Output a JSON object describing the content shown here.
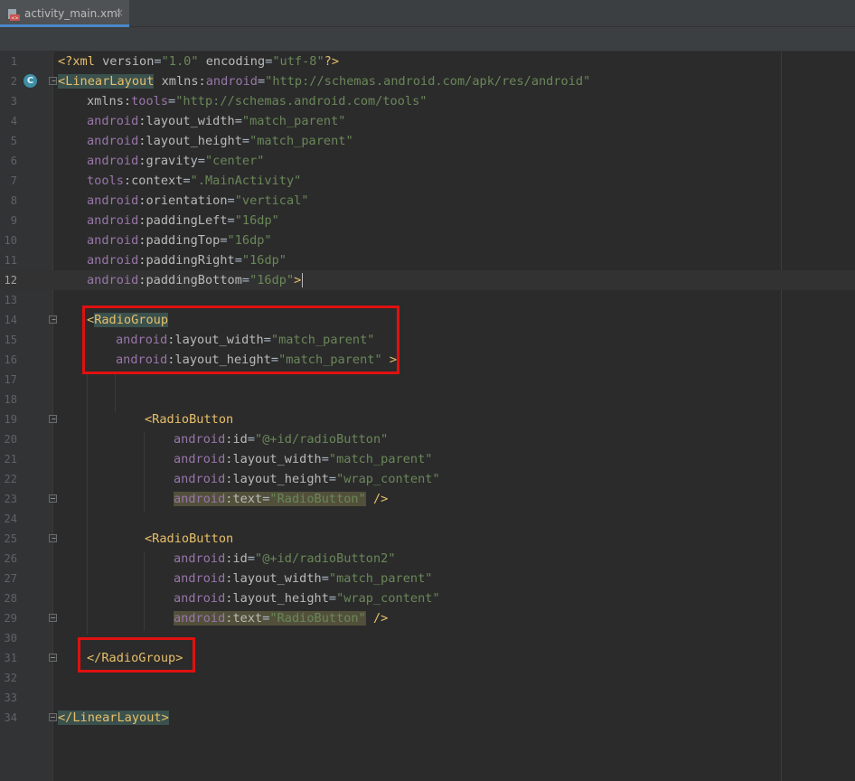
{
  "tab": {
    "filename": "activity_main.xml",
    "close": "×"
  },
  "gutter": {
    "badge": "C"
  },
  "lines": [
    {
      "n": "1"
    },
    {
      "n": "2"
    },
    {
      "n": "3"
    },
    {
      "n": "4"
    },
    {
      "n": "5"
    },
    {
      "n": "6"
    },
    {
      "n": "7"
    },
    {
      "n": "8"
    },
    {
      "n": "9"
    },
    {
      "n": "10"
    },
    {
      "n": "11"
    },
    {
      "n": "12"
    },
    {
      "n": "13"
    },
    {
      "n": "14"
    },
    {
      "n": "15"
    },
    {
      "n": "16"
    },
    {
      "n": "17"
    },
    {
      "n": "18"
    },
    {
      "n": "19"
    },
    {
      "n": "20"
    },
    {
      "n": "21"
    },
    {
      "n": "22"
    },
    {
      "n": "23"
    },
    {
      "n": "24"
    },
    {
      "n": "25"
    },
    {
      "n": "26"
    },
    {
      "n": "27"
    },
    {
      "n": "28"
    },
    {
      "n": "29"
    },
    {
      "n": "30"
    },
    {
      "n": "31"
    },
    {
      "n": "32"
    },
    {
      "n": "33"
    },
    {
      "n": "34"
    }
  ],
  "code": {
    "l1": {
      "open": "<?xml ",
      "a1": "version",
      "eq1": "=",
      "v1": "\"1.0\"",
      "sp": " ",
      "a2": "encoding",
      "eq2": "=",
      "v2": "\"utf-8\"",
      "close": "?>"
    },
    "l2": {
      "lt": "<",
      "tag": "LinearLayout",
      "sp": " ",
      "ns": "xmlns:",
      "nsn": "android",
      "eq": "=",
      "val": "\"http://schemas.android.com/apk/res/android\""
    },
    "l3": {
      "ns": "xmlns:",
      "nsn": "tools",
      "eq": "=",
      "val": "\"http://schemas.android.com/tools\""
    },
    "l4": {
      "ns": "android",
      "attr": ":layout_width",
      "eq": "=",
      "val": "\"match_parent\""
    },
    "l5": {
      "ns": "android",
      "attr": ":layout_height",
      "eq": "=",
      "val": "\"match_parent\""
    },
    "l6": {
      "ns": "android",
      "attr": ":gravity",
      "eq": "=",
      "val": "\"center\""
    },
    "l7": {
      "ns": "tools",
      "attr": ":context",
      "eq": "=",
      "val": "\".MainActivity\""
    },
    "l8": {
      "ns": "android",
      "attr": ":orientation",
      "eq": "=",
      "val": "\"vertical\""
    },
    "l9": {
      "ns": "android",
      "attr": ":paddingLeft",
      "eq": "=",
      "val": "\"16dp\""
    },
    "l10": {
      "ns": "android",
      "attr": ":paddingTop",
      "eq": "=",
      "val": "\"16dp\""
    },
    "l11": {
      "ns": "android",
      "attr": ":paddingRight",
      "eq": "=",
      "val": "\"16dp\""
    },
    "l12": {
      "ns": "android",
      "attr": ":paddingBottom",
      "eq": "=",
      "val": "\"16dp\"",
      "gt": ">"
    },
    "l14": {
      "lt": "<",
      "tag": "RadioGroup"
    },
    "l15": {
      "ns": "android",
      "attr": ":layout_width",
      "eq": "=",
      "val": "\"match_parent\""
    },
    "l16": {
      "ns": "android",
      "attr": ":layout_height",
      "eq": "=",
      "val": "\"match_parent\"",
      "gt": " >"
    },
    "l19": {
      "tag": "<RadioButton"
    },
    "l20": {
      "ns": "android",
      "attr": ":id",
      "eq": "=",
      "val": "\"@+id/radioButton\""
    },
    "l21": {
      "ns": "android",
      "attr": ":layout_width",
      "eq": "=",
      "val": "\"match_parent\""
    },
    "l22": {
      "ns": "android",
      "attr": ":layout_height",
      "eq": "=",
      "val": "\"wrap_content\""
    },
    "l23": {
      "ns": "android",
      "attr": ":text",
      "eq": "=",
      "val": "\"RadioButton\"",
      "end": " />"
    },
    "l25": {
      "tag": "<RadioButton"
    },
    "l26": {
      "ns": "android",
      "attr": ":id",
      "eq": "=",
      "val": "\"@+id/radioButton2\""
    },
    "l27": {
      "ns": "android",
      "attr": ":layout_width",
      "eq": "=",
      "val": "\"match_parent\""
    },
    "l28": {
      "ns": "android",
      "attr": ":layout_height",
      "eq": "=",
      "val": "\"wrap_content\""
    },
    "l29": {
      "ns": "android",
      "attr": ":text",
      "eq": "=",
      "val": "\"RadioButton\"",
      "end": " />"
    },
    "l31": {
      "tag": "</RadioGroup>"
    },
    "l34": {
      "tag": "</LinearLayout>"
    }
  },
  "colors": {
    "red_box": "#e01010",
    "tag": "#e8bf6a",
    "namespace": "#9876aa",
    "value": "#6a8759",
    "tab_underline": "#4a88c7"
  }
}
